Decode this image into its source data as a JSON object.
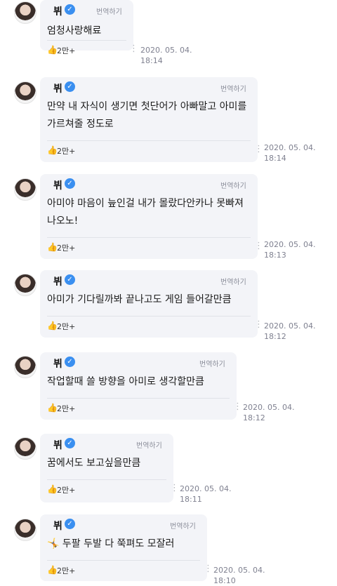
{
  "messages": [
    {
      "name": "뷔",
      "verified": "verified-badge",
      "translate": "번역하기",
      "text": "엄청사랑해료",
      "likes": "2만+",
      "date": "2020. 05. 04.",
      "time": "18:14"
    },
    {
      "name": "뷔",
      "verified": "verified-badge",
      "translate": "번역하기",
      "text": "만약 내 자식이 생기면 첫단어가 아빠말고 아미를\n가르쳐줄 정도로",
      "likes": "2만+",
      "date": "2020. 05. 04.",
      "time": "18:14"
    },
    {
      "name": "뷔",
      "verified": "verified-badge",
      "translate": "번역하기",
      "text": "아미야 마음이 늪인걸 내가 몰랐다안카나 못빠져\n나오노!",
      "likes": "2만+",
      "date": "2020. 05. 04.",
      "time": "18:13"
    },
    {
      "name": "뷔",
      "verified": "verified-badge",
      "translate": "번역하기",
      "text": "아미가 기다릴까봐 끝나고도 게임 들어갈만큼",
      "likes": "2만+",
      "date": "2020. 05. 04.",
      "time": "18:12"
    },
    {
      "name": "뷔",
      "verified": "verified-badge",
      "translate": "번역하기",
      "text": "작업할때 쓸 방향을 아미로 생각할만큼",
      "likes": "2만+",
      "date": "2020. 05. 04.",
      "time": "18:12"
    },
    {
      "name": "뷔",
      "verified": "verified-badge",
      "translate": "번역하기",
      "text": "꿈에서도 보고싶을만큼",
      "likes": "2만+",
      "date": "2020. 05. 04.",
      "time": "18:11"
    },
    {
      "name": "뷔",
      "verified": "verified-badge",
      "translate": "번역하기",
      "text": "🤸 두팔 두발 다 쭉펴도 모잘러",
      "likes": "2만+",
      "date": "2020. 05. 04.",
      "time": "18:10"
    }
  ],
  "icons": {
    "like": "thumbs-up-icon",
    "more": "more-vertical-icon",
    "verified": "check-badge-icon"
  },
  "colors": {
    "bubble": "#f3f4f8",
    "accent": "#3a8ff0",
    "like": "#18b3a8"
  }
}
